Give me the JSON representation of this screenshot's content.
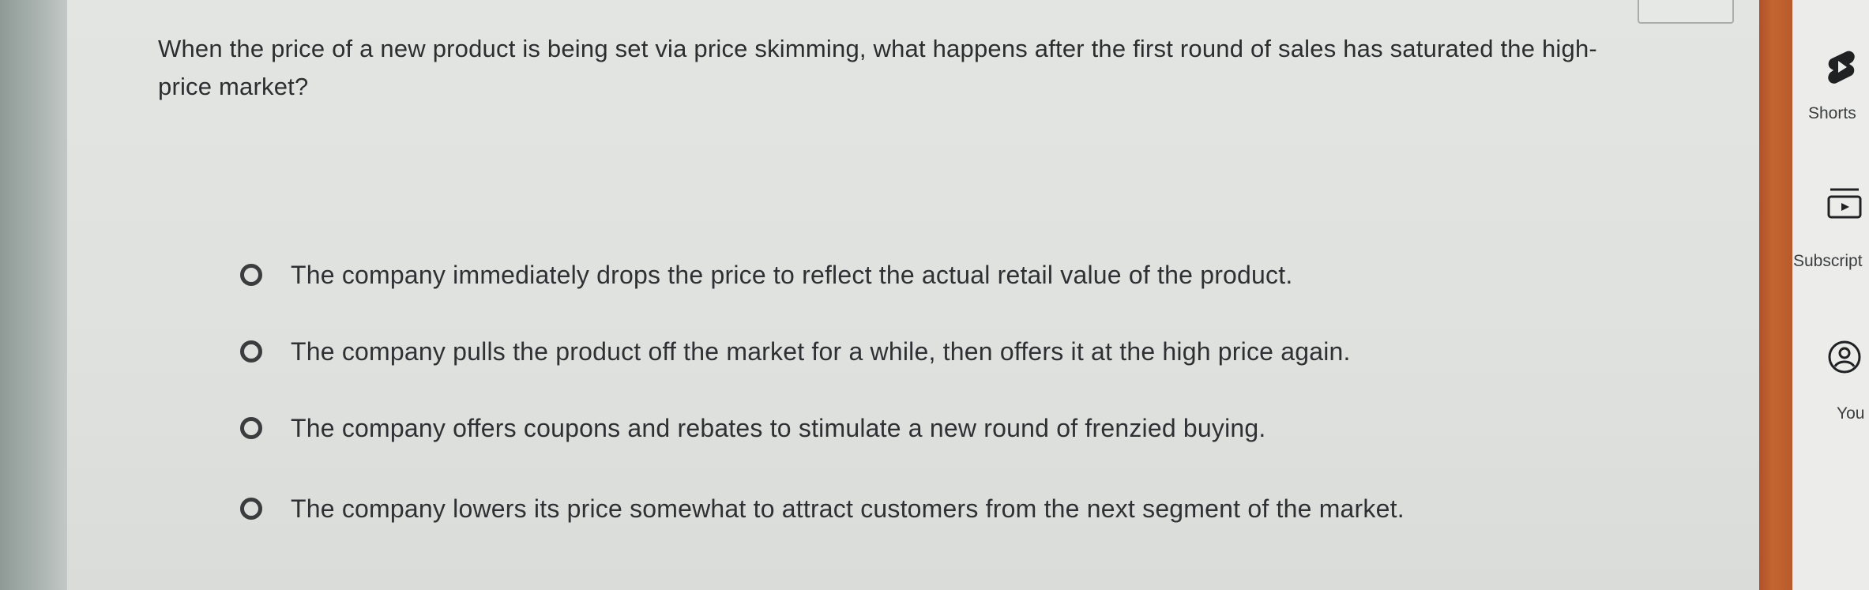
{
  "question": {
    "text": "When the price of a new product is being set via price skimming, what happens after the first round of sales has saturated the high-price market?"
  },
  "options": [
    {
      "label": "The company immediately drops the price to reflect the actual retail value of the product."
    },
    {
      "label": "The company pulls the product off the market for a while, then offers it at the high price again."
    },
    {
      "label": "The company offers coupons and rebates to stimulate a new round of frenzied buying."
    },
    {
      "label": "The company lowers its price somewhat to attract customers from the next segment of the market."
    }
  ],
  "sidebar": {
    "items": [
      {
        "label": "Shorts",
        "icon": "shorts-icon"
      },
      {
        "label": "Subscript",
        "icon": "subscriptions-icon"
      },
      {
        "label": "You",
        "icon": "you-icon"
      }
    ]
  },
  "colors": {
    "accent_strip": "#c4662f",
    "text": "#2b2e2f",
    "panel_background": "#e0e2e0"
  }
}
